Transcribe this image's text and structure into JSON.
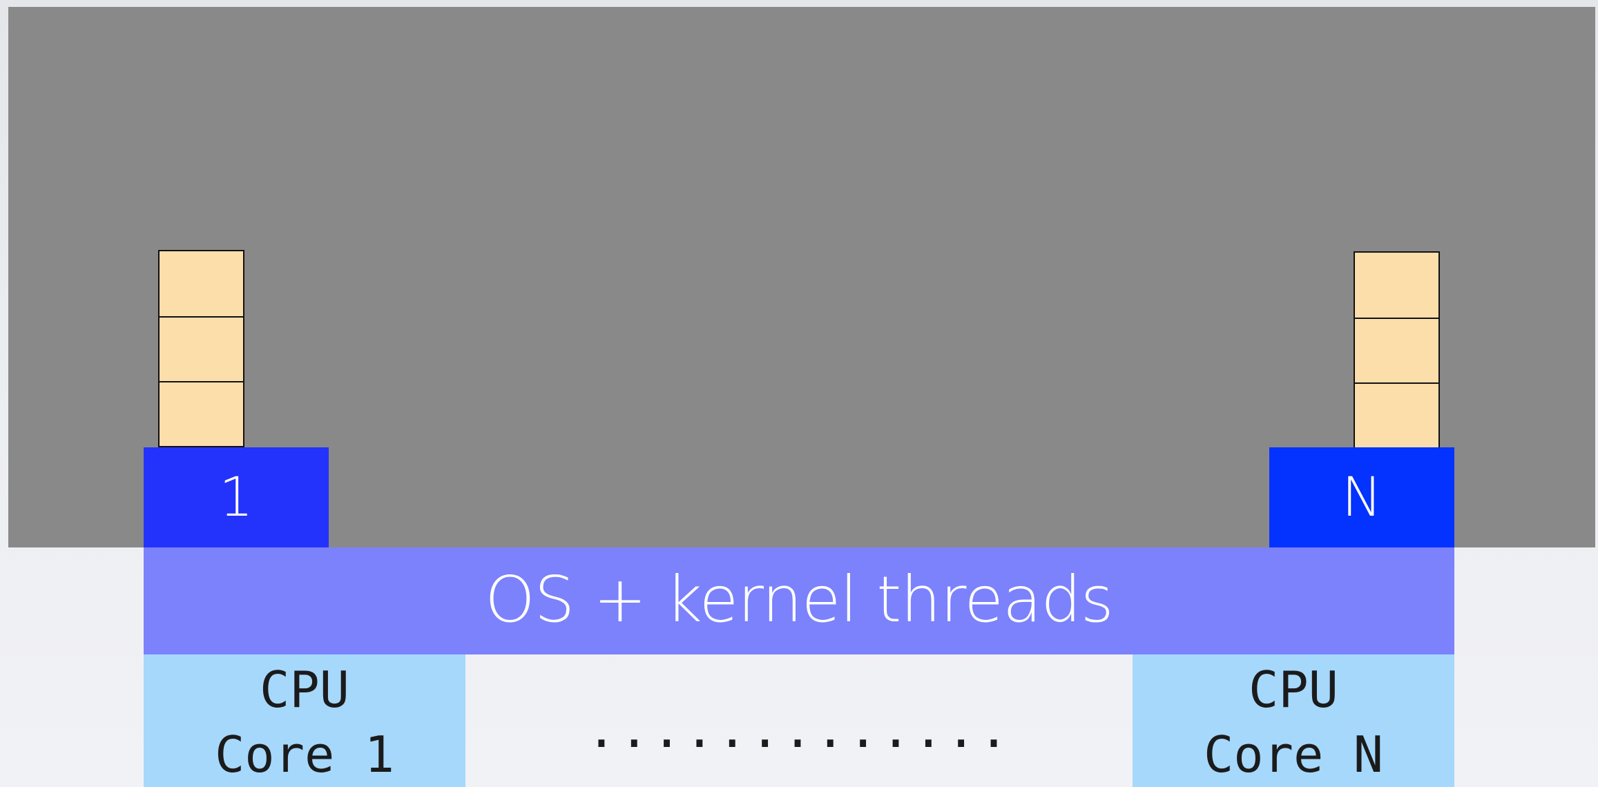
{
  "thread_left": {
    "label": "1"
  },
  "thread_right": {
    "label": "N"
  },
  "os_layer": {
    "label": "OS + kernel threads"
  },
  "cpu_cores": [
    {
      "line1": "CPU",
      "line2": "Core 1"
    },
    {
      "line1": "CPU",
      "line2": "Core N"
    }
  ],
  "ellipsis": ".............",
  "colors": {
    "userspace": "#898989",
    "stack_frame": "#fcdeab",
    "thread_1": "#2433fb",
    "thread_n": "#0432fe",
    "os_layer": "#7b82fc",
    "cpu_core": "#a6d8fc"
  }
}
